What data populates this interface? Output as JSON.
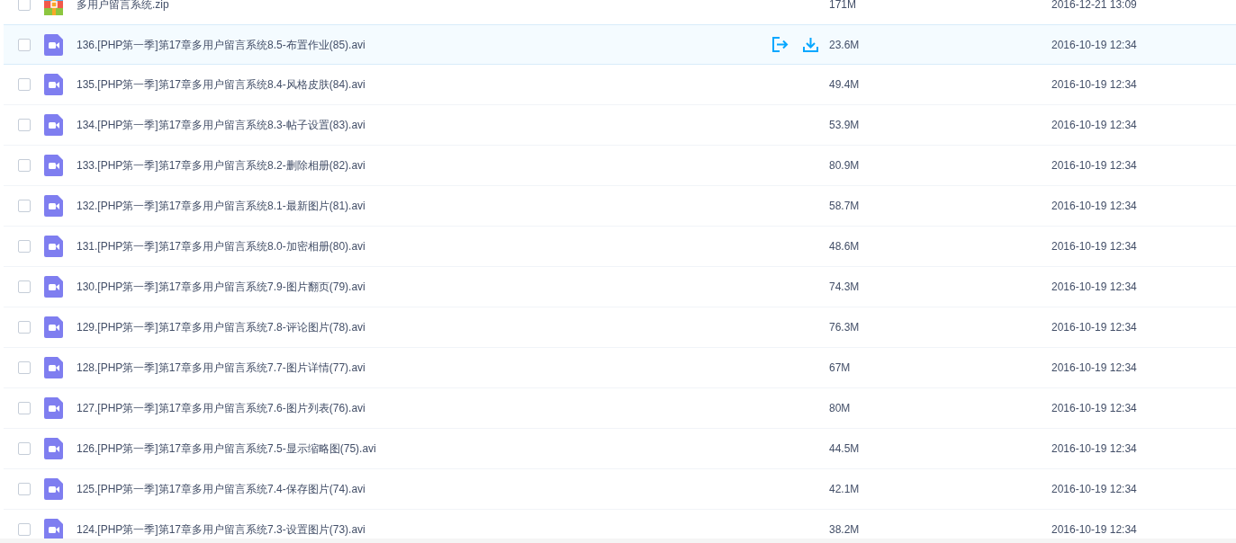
{
  "files": [
    {
      "kind": "archive",
      "name": "多用户留言系统.zip",
      "size": "171M",
      "modified": "2016-12-21 13:09",
      "hovered": false
    },
    {
      "kind": "video",
      "name": "136.[PHP第一季]第17章多用户留言系统8.5-布置作业(85).avi",
      "size": "23.6M",
      "modified": "2016-10-19 12:34",
      "hovered": true
    },
    {
      "kind": "video",
      "name": "135.[PHP第一季]第17章多用户留言系统8.4-风格皮肤(84).avi",
      "size": "49.4M",
      "modified": "2016-10-19 12:34",
      "hovered": false
    },
    {
      "kind": "video",
      "name": "134.[PHP第一季]第17章多用户留言系统8.3-帖子设置(83).avi",
      "size": "53.9M",
      "modified": "2016-10-19 12:34",
      "hovered": false
    },
    {
      "kind": "video",
      "name": "133.[PHP第一季]第17章多用户留言系统8.2-删除相册(82).avi",
      "size": "80.9M",
      "modified": "2016-10-19 12:34",
      "hovered": false
    },
    {
      "kind": "video",
      "name": "132.[PHP第一季]第17章多用户留言系统8.1-最新图片(81).avi",
      "size": "58.7M",
      "modified": "2016-10-19 12:34",
      "hovered": false
    },
    {
      "kind": "video",
      "name": "131.[PHP第一季]第17章多用户留言系统8.0-加密相册(80).avi",
      "size": "48.6M",
      "modified": "2016-10-19 12:34",
      "hovered": false
    },
    {
      "kind": "video",
      "name": "130.[PHP第一季]第17章多用户留言系统7.9-图片翻页(79).avi",
      "size": "74.3M",
      "modified": "2016-10-19 12:34",
      "hovered": false
    },
    {
      "kind": "video",
      "name": "129.[PHP第一季]第17章多用户留言系统7.8-评论图片(78).avi",
      "size": "76.3M",
      "modified": "2016-10-19 12:34",
      "hovered": false
    },
    {
      "kind": "video",
      "name": "128.[PHP第一季]第17章多用户留言系统7.7-图片详情(77).avi",
      "size": "67M",
      "modified": "2016-10-19 12:34",
      "hovered": false
    },
    {
      "kind": "video",
      "name": "127.[PHP第一季]第17章多用户留言系统7.6-图片列表(76).avi",
      "size": "80M",
      "modified": "2016-10-19 12:34",
      "hovered": false
    },
    {
      "kind": "video",
      "name": "126.[PHP第一季]第17章多用户留言系统7.5-显示缩略图(75).avi",
      "size": "44.5M",
      "modified": "2016-10-19 12:34",
      "hovered": false
    },
    {
      "kind": "video",
      "name": "125.[PHP第一季]第17章多用户留言系统7.4-保存图片(74).avi",
      "size": "42.1M",
      "modified": "2016-10-19 12:34",
      "hovered": false
    },
    {
      "kind": "video",
      "name": "124.[PHP第一季]第17章多用户留言系统7.3-设置图片(73).avi",
      "size": "38.2M",
      "modified": "2016-10-19 12:34",
      "hovered": false
    }
  ]
}
